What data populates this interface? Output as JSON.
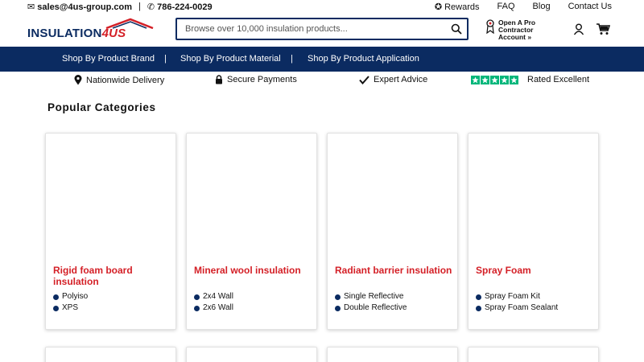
{
  "topbar": {
    "email": "✉ sales@4us-group.com",
    "separator": "|",
    "phone": "✆ 786-224-0029",
    "links": {
      "rewards": "✪ Rewards",
      "faq": "FAQ",
      "blog": "Blog",
      "contact": "Contact Us"
    }
  },
  "logo": {
    "main": "INSULATION",
    "accent": "4US"
  },
  "search": {
    "placeholder": "Browse over 10,000 insulation products...",
    "icon": "search-icon"
  },
  "pro_account": {
    "line1": "Open A Pro",
    "line2": "Contractor",
    "line3": "Account »"
  },
  "icons": {
    "account": "account-icon",
    "cart": "cart-icon"
  },
  "nav": {
    "brand": "Shop By Product Brand",
    "material": "Shop By Product Material",
    "application": "Shop By Product Application",
    "pipe": "|"
  },
  "features": {
    "delivery": "Nationwide Delivery",
    "payments": "Secure Payments",
    "advice": "Expert Advice",
    "rating": "Rated Excellent"
  },
  "main": {
    "title": "Popular Categories",
    "categories": [
      {
        "title": "Rigid foam board insulation",
        "items": [
          "Polyiso",
          "XPS"
        ]
      },
      {
        "title": "Mineral wool insulation",
        "items": [
          "2x4 Wall",
          "2x6 Wall"
        ]
      },
      {
        "title": "Radiant barrier insulation",
        "items": [
          "Single Reflective",
          "Double Reflective"
        ]
      },
      {
        "title": "Spray Foam",
        "items": [
          "Spray Foam Kit",
          "Spray Foam Sealant"
        ]
      }
    ]
  },
  "colors": {
    "navy": "#0b2b61",
    "red": "#d42027",
    "trustpilot": "#00b67a"
  }
}
